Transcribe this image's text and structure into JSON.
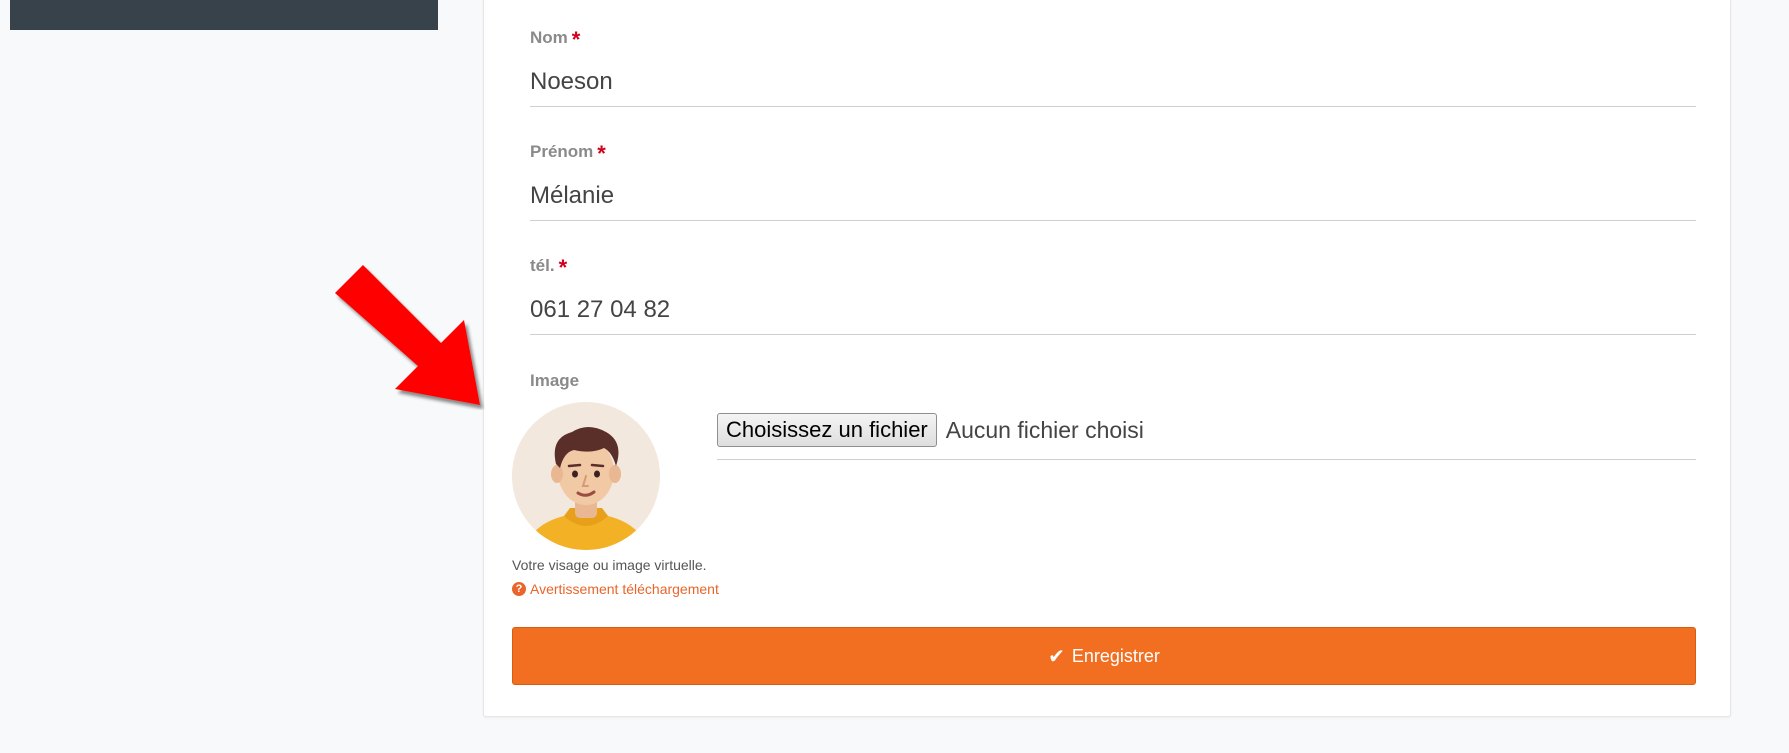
{
  "form": {
    "nom": {
      "label": "Nom",
      "required_mark": "*",
      "value": "Noeson"
    },
    "prenom": {
      "label": "Prénom",
      "required_mark": "*",
      "value": "Mélanie"
    },
    "tel": {
      "label": "tél.",
      "required_mark": "*",
      "value": "061 27 04 82"
    },
    "image": {
      "label": "Image",
      "choose_button": "Choisissez un fichier",
      "file_status": "Aucun fichier choisi",
      "help_text": "Votre visage ou image virtuelle.",
      "warning_link": "Avertissement téléchargement",
      "warning_icon_glyph": "?"
    },
    "submit": {
      "label": "Enregistrer",
      "icon_glyph": "✔"
    }
  },
  "icons": {
    "annotation_arrow": "red-arrow-icon",
    "avatar": "avatar-icon",
    "warning": "question-circle-icon",
    "submit": "check-icon"
  },
  "colors": {
    "accent": "#f26f21",
    "required": "#d0021b",
    "warning_link": "#e9652b",
    "sidebar": "#37424a",
    "annotation_arrow": "#ff0000"
  }
}
